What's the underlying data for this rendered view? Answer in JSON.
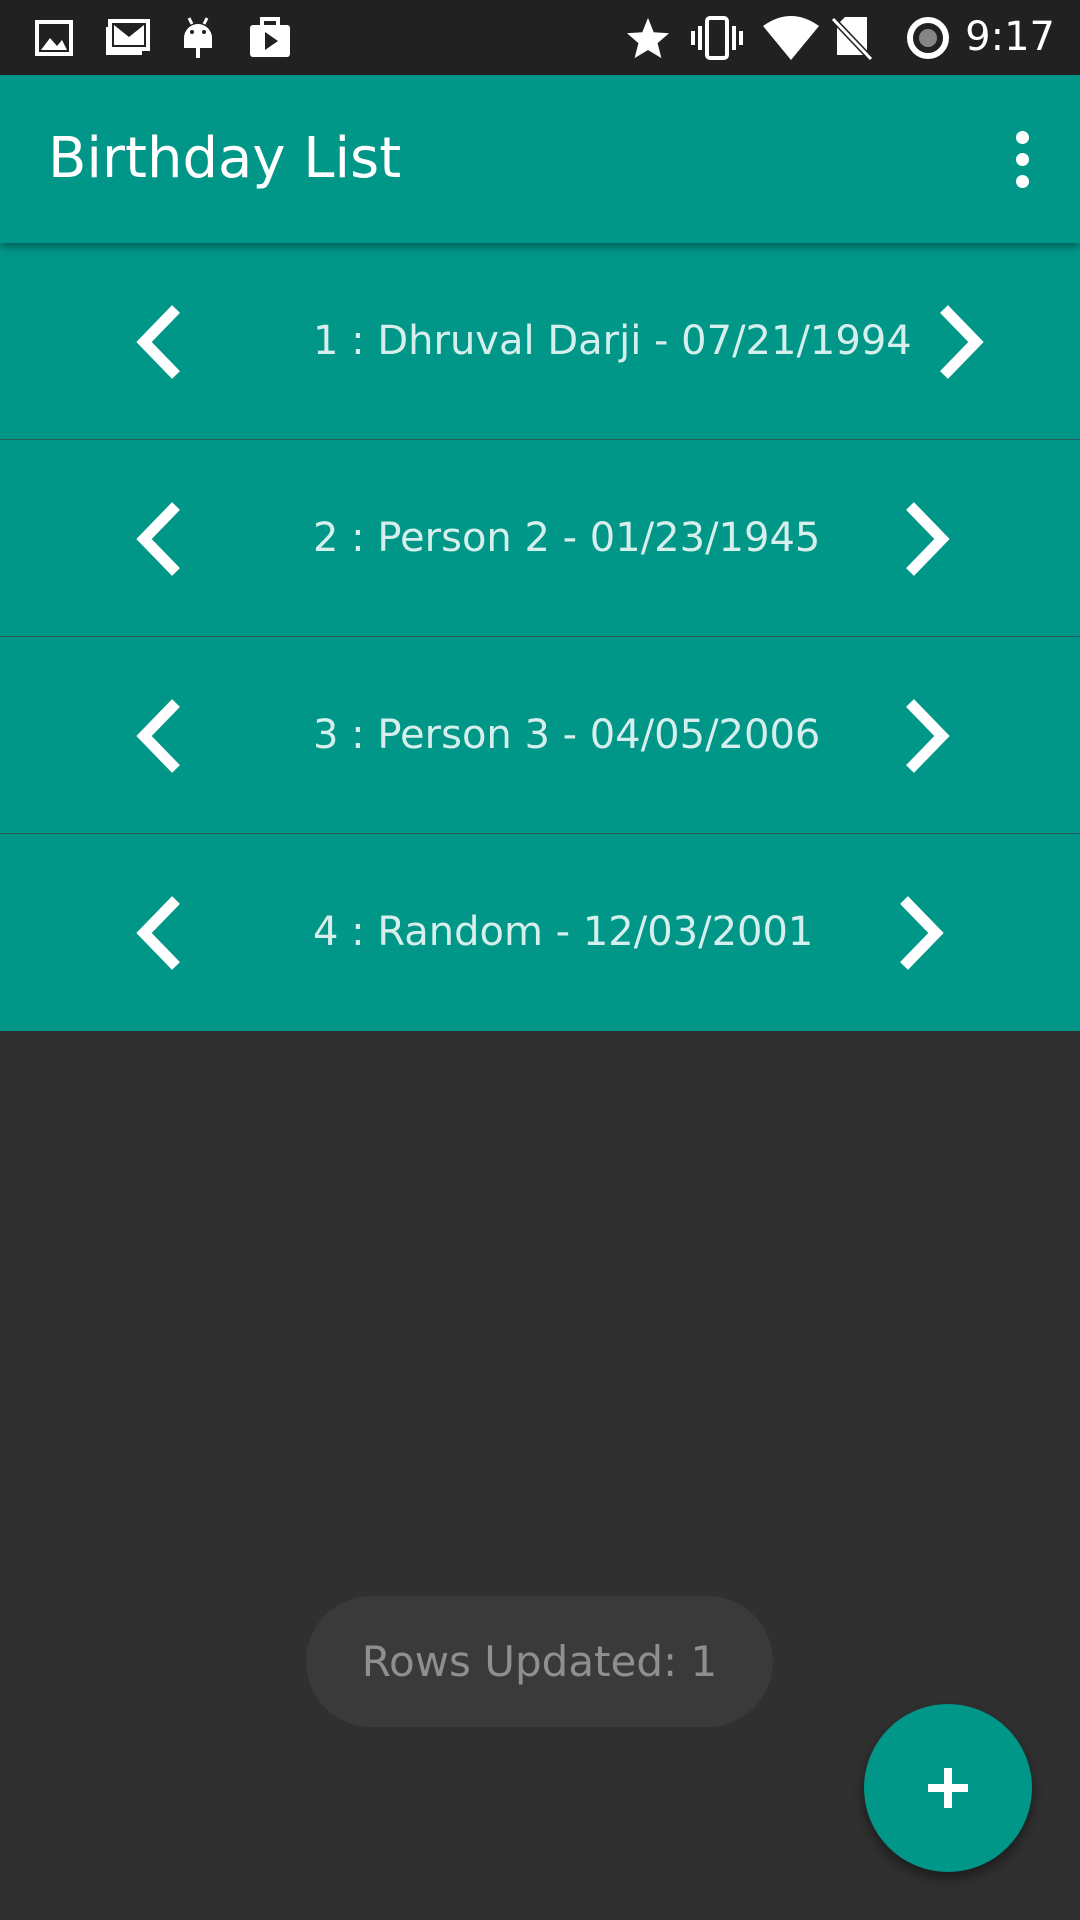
{
  "status_bar": {
    "time": "9:17",
    "left_icons": [
      "image-icon",
      "gmail-icon",
      "android-icon",
      "play-store-icon"
    ],
    "right_icons": [
      "star-icon",
      "vibrate-icon",
      "wifi-icon",
      "no-sim-icon",
      "sync-icon"
    ]
  },
  "app_bar": {
    "title": "Birthday List",
    "menu_icon": "more-vert-icon"
  },
  "rows": [
    {
      "text": "1 : Dhruval Darji - 07/21/1994"
    },
    {
      "text": "2 : Person 2 - 01/23/1945"
    },
    {
      "text": "3 : Person 3 - 04/05/2006"
    },
    {
      "text": "4 : Random - 12/03/2001"
    }
  ],
  "toast": {
    "text": "Rows Updated: 1"
  },
  "fab": {
    "icon": "plus-icon"
  },
  "colors": {
    "primary": "#009688",
    "status_bar": "#212121",
    "background": "#303030"
  }
}
